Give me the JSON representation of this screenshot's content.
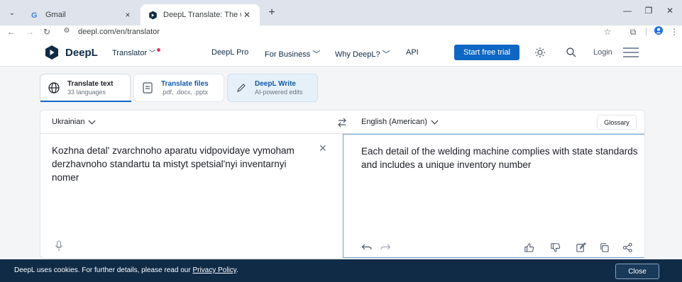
{
  "browser": {
    "tabs": [
      {
        "title": "Gmail",
        "active": false
      },
      {
        "title": "DeepL Translate: The world's m",
        "active": true
      }
    ],
    "new_tab_label": "+",
    "url": "deepl.com/en/translator",
    "window_controls": {
      "minimize": "—",
      "maximize": "❐",
      "close": "✕"
    }
  },
  "header": {
    "brand": "DeepL",
    "translator_label": "Translator",
    "nav": [
      "DeepL Pro",
      "For Business",
      "Why DeepL?",
      "API"
    ],
    "trial_button": "Start free trial",
    "login": "Login"
  },
  "modes": [
    {
      "title": "Translate text",
      "subtitle": "33 languages"
    },
    {
      "title": "Translate files",
      "subtitle": ".pdf, .docx, .pptx"
    },
    {
      "title": "DeepL Write",
      "subtitle": "AI-powered edits"
    }
  ],
  "translator": {
    "source_lang": "Ukrainian",
    "target_lang": "English (American)",
    "glossary": "Glossary",
    "source_text": "Kozhna detal' zvarchnoho aparatu vidpovidaye vymoham derzhavnoho standartu ta mistyt spetsial'nyi inventarnyi nomer",
    "target_text": "Each detail of the welding machine complies with state standards and includes a unique inventory number"
  },
  "cookie_banner": {
    "text": "DeepL uses cookies. For further details, please read our ",
    "link": "Privacy Policy",
    "end": ".",
    "close": "Close"
  },
  "colors": {
    "brand_navy": "#0f2b46",
    "accent_blue": "#0f67c5",
    "notification_dot": "#e2355f"
  }
}
